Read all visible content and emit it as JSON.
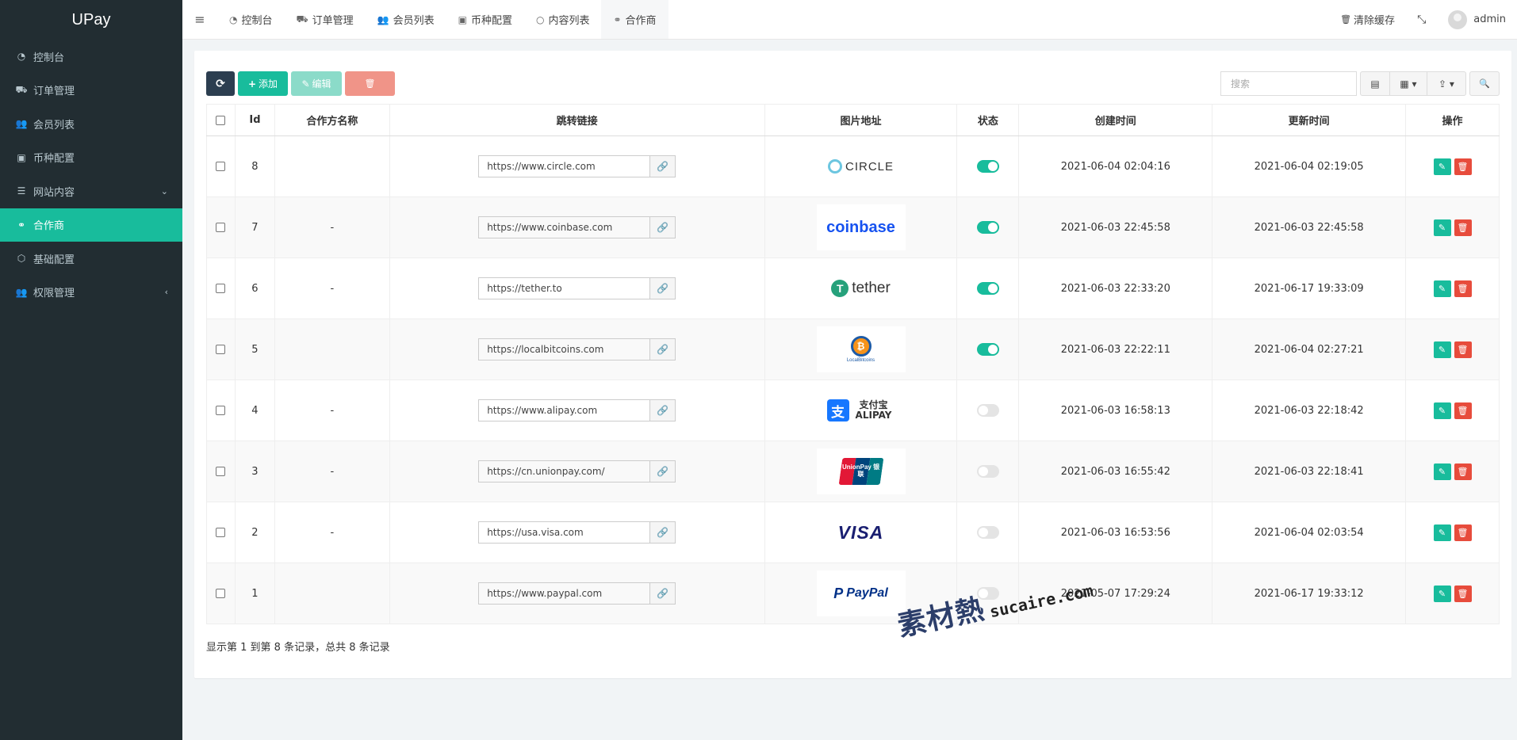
{
  "app": {
    "name": "UPay"
  },
  "sidebar": {
    "items": [
      {
        "label": "控制台",
        "icon": "dashboard-icon",
        "glyph": "◔"
      },
      {
        "label": "订单管理",
        "icon": "cart-icon",
        "glyph": "⛟"
      },
      {
        "label": "会员列表",
        "icon": "users-icon",
        "glyph": "👥"
      },
      {
        "label": "币种配置",
        "icon": "money-icon",
        "glyph": "▣"
      },
      {
        "label": "网站内容",
        "icon": "list-icon",
        "glyph": "☰",
        "arrow": "⌄"
      },
      {
        "label": "合作商",
        "icon": "handshake-icon",
        "glyph": "⚭",
        "active": true
      },
      {
        "label": "基础配置",
        "icon": "cube-icon",
        "glyph": "⬡"
      },
      {
        "label": "权限管理",
        "icon": "group-icon",
        "glyph": "👥",
        "arrow": "‹"
      }
    ]
  },
  "topbar": {
    "menu_glyph": "≡",
    "tabs": [
      {
        "label": "控制台",
        "glyph": "◔"
      },
      {
        "label": "订单管理",
        "glyph": "⛟"
      },
      {
        "label": "会员列表",
        "glyph": "👥"
      },
      {
        "label": "币种配置",
        "glyph": "▣"
      },
      {
        "label": "内容列表",
        "glyph": "○"
      },
      {
        "label": "合作商",
        "glyph": "⚭",
        "active": true
      }
    ],
    "clear_cache": "清除缓存",
    "clear_cache_glyph": "🗑",
    "fullscreen_glyph": "⤡",
    "user": "admin"
  },
  "toolbar": {
    "refresh_glyph": "⟳",
    "add_label": "添加",
    "add_glyph": "+",
    "edit_label": "编辑",
    "edit_glyph": "✎",
    "delete_glyph": "🗑",
    "search_placeholder": "搜索",
    "view_glyph": "▤",
    "columns_glyph": "▦ ▾",
    "export_glyph": "⇪ ▾",
    "search_glyph": "🔍"
  },
  "table": {
    "headers": [
      "Id",
      "合作方名称",
      "跳转链接",
      "图片地址",
      "状态",
      "创建时间",
      "更新时间",
      "操作"
    ],
    "rows": [
      {
        "id": "8",
        "name": "",
        "url": "https://www.circle.com",
        "logo": "CIRCLE",
        "status": "on",
        "created": "2021-06-04 02:04:16",
        "updated": "2021-06-04 02:19:05"
      },
      {
        "id": "7",
        "name": "-",
        "url": "https://www.coinbase.com",
        "logo": "coinbase",
        "status": "on",
        "created": "2021-06-03 22:45:58",
        "updated": "2021-06-03 22:45:58"
      },
      {
        "id": "6",
        "name": "-",
        "url": "https://tether.to",
        "logo": "tether",
        "status": "on",
        "created": "2021-06-03 22:33:20",
        "updated": "2021-06-17 19:33:09"
      },
      {
        "id": "5",
        "name": "",
        "url": "https://localbitcoins.com",
        "logo": "LocalBitcoins",
        "status": "on",
        "created": "2021-06-03 22:22:11",
        "updated": "2021-06-04 02:27:21"
      },
      {
        "id": "4",
        "name": "-",
        "url": "https://www.alipay.com",
        "logo": "支付宝 ALIPAY",
        "status": "off",
        "created": "2021-06-03 16:58:13",
        "updated": "2021-06-03 22:18:42"
      },
      {
        "id": "3",
        "name": "-",
        "url": "https://cn.unionpay.com/",
        "logo": "UnionPay 银联",
        "status": "off",
        "created": "2021-06-03 16:55:42",
        "updated": "2021-06-03 22:18:41"
      },
      {
        "id": "2",
        "name": "-",
        "url": "https://usa.visa.com",
        "logo": "VISA",
        "status": "off",
        "created": "2021-06-03 16:53:56",
        "updated": "2021-06-04 02:03:54"
      },
      {
        "id": "1",
        "name": "",
        "url": "https://www.paypal.com",
        "logo": "PayPal",
        "status": "off",
        "created": "2021-05-07 17:29:24",
        "updated": "2021-06-17 19:33:12"
      }
    ]
  },
  "footer": {
    "info": "显示第 1 到第 8 条记录，总共 8 条记录"
  },
  "watermark": {
    "mark": "素材熱",
    "text": "sucaire.com"
  },
  "colors": {
    "sidebar_bg": "#222d32",
    "accent": "#18bc9c",
    "danger": "#e74c3c",
    "dark": "#2c3e50"
  }
}
